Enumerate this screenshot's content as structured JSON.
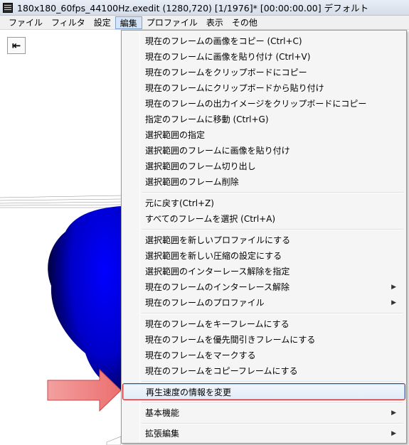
{
  "window": {
    "title": "180x180_60fps_44100Hz.exedit (1280,720)  [1/1976]* [00:00:00.00]  デフォルト",
    "icon": "film-icon"
  },
  "menubar": {
    "items": [
      "ファイル",
      "フィルタ",
      "設定",
      "編集",
      "プロファイル",
      "表示",
      "その他"
    ],
    "active": "編集"
  },
  "toolbar": {
    "go_start_icon": "skip-to-start-icon",
    "go_start_glyph": "⇤"
  },
  "edit_menu": {
    "items": [
      {
        "label": "現在のフレームの画像をコピー (Ctrl+C)"
      },
      {
        "label": "現在のフレームに画像を貼り付け (Ctrl+V)"
      },
      {
        "label": "現在のフレームをクリップボードにコピー"
      },
      {
        "label": "現在のフレームにクリップボードから貼り付け"
      },
      {
        "label": "現在のフレームの出力イメージをクリップボードにコピー"
      },
      {
        "label": "指定のフレームに移動 (Ctrl+G)"
      },
      {
        "label": "選択範囲の指定"
      },
      {
        "label": "選択範囲のフレームに画像を貼り付け"
      },
      {
        "label": "選択範囲のフレーム切り出し"
      },
      {
        "label": "選択範囲のフレーム削除"
      },
      {
        "label": "元に戻す(Ctrl+Z)"
      },
      {
        "label": "すべてのフレームを選択 (Ctrl+A)"
      },
      {
        "label": "選択範囲を新しいプロファイルにする"
      },
      {
        "label": "選択範囲を新しい圧縮の設定にする"
      },
      {
        "label": "選択範囲のインターレース解除を指定"
      },
      {
        "label": "現在のフレームのインターレース解除",
        "submenu": true
      },
      {
        "label": "現在のフレームのプロファイル",
        "submenu": true
      },
      {
        "label": "現在のフレームをキーフレームにする"
      },
      {
        "label": "現在のフレームを優先間引きフレームにする"
      },
      {
        "label": "現在のフレームをマークする"
      },
      {
        "label": "現在のフレームをコピーフレームにする"
      },
      {
        "label": "再生速度の情報を変更",
        "highlighted": true
      },
      {
        "label": "基本機能",
        "submenu": true
      },
      {
        "label": "拡張編集",
        "submenu": true
      }
    ],
    "submenu_glyph": "▶"
  },
  "annotation": {
    "pointer": "callout-arrow",
    "color": "#f07a7a",
    "outline_color": "#d02020"
  },
  "stage": {
    "shape_color_center": "#0000ff",
    "shape_color_edge": "#000018"
  }
}
